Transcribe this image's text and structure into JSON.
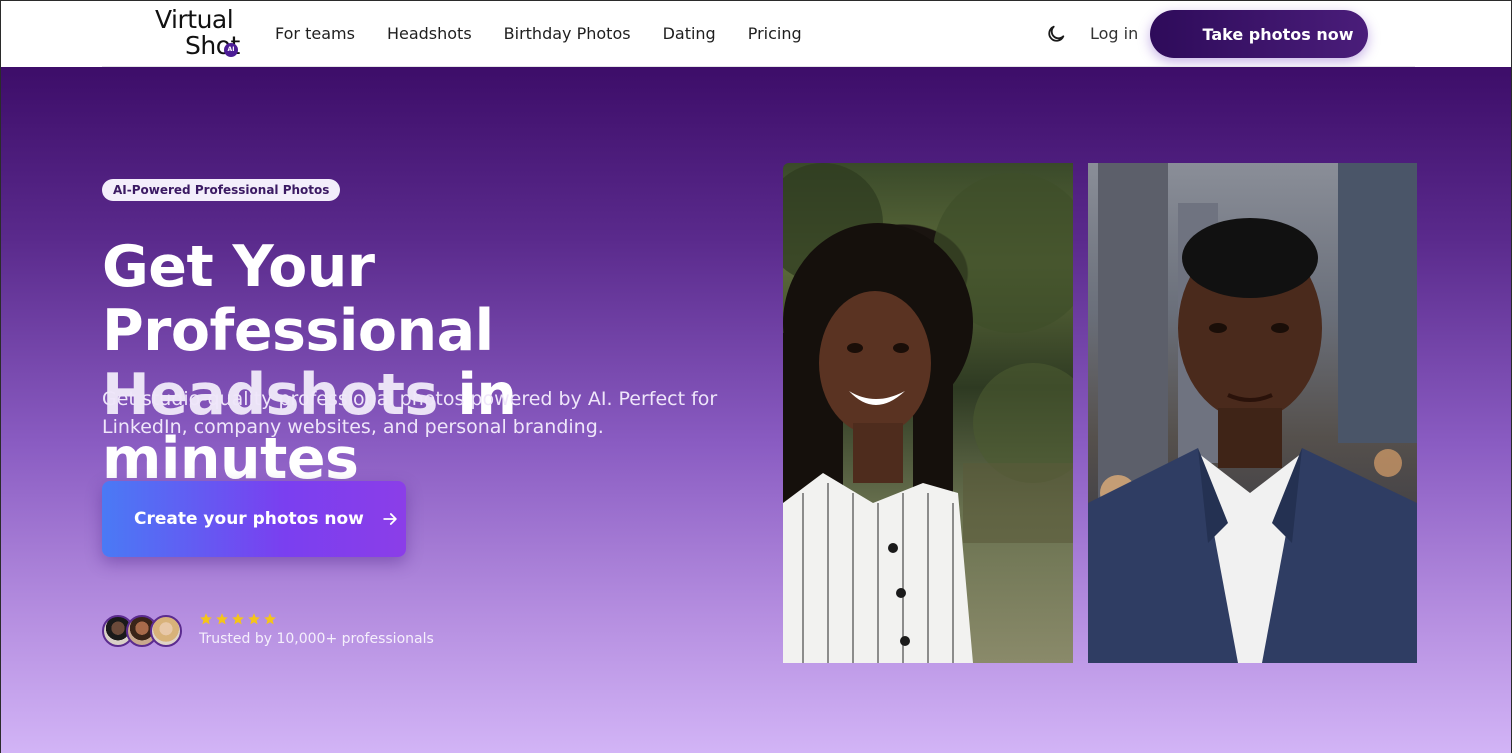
{
  "header": {
    "logo": {
      "line1": "Virtual",
      "line2": "Shot",
      "badge": "AI"
    },
    "nav": [
      {
        "label": "For teams"
      },
      {
        "label": "Headshots"
      },
      {
        "label": "Birthday Photos"
      },
      {
        "label": "Dating"
      },
      {
        "label": "Pricing"
      }
    ],
    "theme_toggle_icon": "moon-icon",
    "login_label": "Log in",
    "cta_label": "Take photos now"
  },
  "hero": {
    "badge": "AI-Powered Professional Photos",
    "headline": {
      "line1": "Get Your Professional",
      "accent": "Headshots",
      "rest": " in minutes"
    },
    "subtext": "Get studio-quality professional photos powered by AI. Perfect for LinkedIn, company websites, and personal branding.",
    "cta_label": "Create your photos now",
    "cta_icon": "arrow-right-icon",
    "rating_stars": 5,
    "trusted_text": "Trusted by 10,000+ professionals"
  },
  "photos": {
    "before": "woman-casual-photo",
    "after": "man-professional-headshot"
  },
  "colors": {
    "brand_dark": "#3d0d69",
    "star": "#f5c518",
    "cta_gradient_start": "#4a7af5",
    "cta_gradient_end": "#8b3ee8"
  }
}
